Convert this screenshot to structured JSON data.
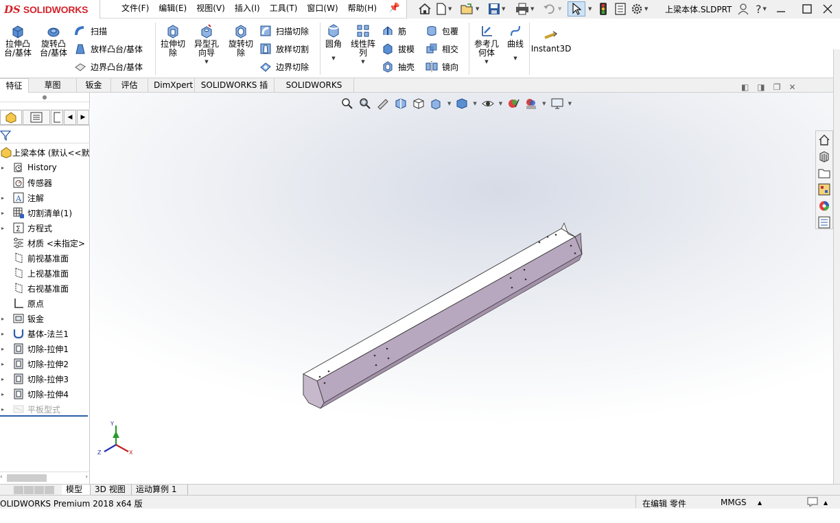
{
  "app": {
    "brand_prefix": "DS",
    "brand_name": "SOLIDWORKS"
  },
  "menu": [
    "文件(F)",
    "编辑(E)",
    "视图(V)",
    "插入(I)",
    "工具(T)",
    "窗口(W)",
    "帮助(H)"
  ],
  "document_title": "上梁本体.SLDPRT",
  "quick_access": {
    "help": "?"
  },
  "ribbon": {
    "extrude_boss": "拉伸凸台/基体",
    "revolve_boss": "旋转凸台/基体",
    "sweep": "扫描",
    "loft_boss": "放样凸台/基体",
    "boundary_boss": "边界凸台/基体",
    "extrude_cut": "拉伸切除",
    "hole_wizard": "异型孔向导",
    "revolve_cut": "旋转切除",
    "sweep_cut": "扫描切除",
    "loft_cut": "放样切割",
    "boundary_cut": "边界切除",
    "fillet": "圆角",
    "linear_pattern": "线性阵列",
    "rib": "筋",
    "draft": "拔模",
    "shell": "抽壳",
    "wrap": "包覆",
    "intersect": "相交",
    "mirror": "镜向",
    "ref_geometry": "参考几何体",
    "curves": "曲线",
    "instant3d": "Instant3D"
  },
  "tabs": [
    "特征",
    "草图",
    "钣金",
    "评估",
    "DimXpert",
    "SOLIDWORKS 插件",
    "SOLIDWORKS MBD"
  ],
  "tree": {
    "root": "上梁本体 (默认<<默",
    "items": [
      {
        "label": "History",
        "icon": "history-icon",
        "expand": true
      },
      {
        "label": "传感器",
        "icon": "sensor-icon",
        "expand": false
      },
      {
        "label": "注解",
        "icon": "annotation-icon",
        "expand": true
      },
      {
        "label": "切割清单(1)",
        "icon": "cut-list-icon",
        "expand": true
      },
      {
        "label": "方程式",
        "icon": "equation-icon",
        "expand": true
      },
      {
        "label": "材质 <未指定>",
        "icon": "material-icon",
        "expand": false
      },
      {
        "label": "前视基准面",
        "icon": "plane-icon",
        "expand": false
      },
      {
        "label": "上视基准面",
        "icon": "plane-icon",
        "expand": false
      },
      {
        "label": "右视基准面",
        "icon": "plane-icon",
        "expand": false
      },
      {
        "label": "原点",
        "icon": "origin-icon",
        "expand": false
      },
      {
        "label": "钣金",
        "icon": "sheet-metal-icon",
        "expand": true
      },
      {
        "label": "基体-法兰1",
        "icon": "base-flange-icon",
        "expand": true
      },
      {
        "label": "切除-拉伸1",
        "icon": "cut-extrude-icon",
        "expand": true
      },
      {
        "label": "切除-拉伸2",
        "icon": "cut-extrude-icon",
        "expand": true
      },
      {
        "label": "切除-拉伸3",
        "icon": "cut-extrude-icon",
        "expand": true
      },
      {
        "label": "切除-拉伸4",
        "icon": "cut-extrude-icon",
        "expand": true
      },
      {
        "label": "平板型式",
        "icon": "flat-pattern-icon",
        "expand": true,
        "dim": true
      }
    ]
  },
  "triad": {
    "x": "X",
    "y": "Y",
    "z": "Z"
  },
  "bottom_tabs": [
    "模型",
    "3D 视图",
    "运动算例 1"
  ],
  "status": {
    "product": "OLIDWORKS Premium 2018 x64 版",
    "editing": "在编辑 零件",
    "units": "MMGS"
  },
  "colors": {
    "brand_red": "#d2232a",
    "part_side": "#b8a8bf",
    "part_top": "#ffffff"
  }
}
